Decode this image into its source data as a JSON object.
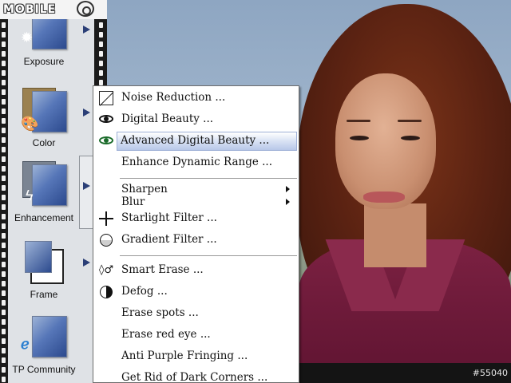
{
  "logo": {
    "text": "MOBILE"
  },
  "sidebar": {
    "tools": [
      {
        "label": "Exposure"
      },
      {
        "label": "Color"
      },
      {
        "label": "Enhancement"
      },
      {
        "label": "Frame"
      },
      {
        "label": "TP Community"
      }
    ]
  },
  "menu": {
    "items": [
      {
        "label": "Noise Reduction ...",
        "icon": "noise-reduction-icon"
      },
      {
        "label": "Digital Beauty ...",
        "icon": "eye-icon"
      },
      {
        "label": "Advanced Digital Beauty ...",
        "icon": "green-eye-icon",
        "highlighted": true
      },
      {
        "label": "Enhance Dynamic Range ...",
        "icon": ""
      },
      {
        "label": "Sharpen",
        "submenu": true
      },
      {
        "label": "Blur",
        "submenu": true
      },
      {
        "label": "Starlight Filter ...",
        "icon": "starlight-icon"
      },
      {
        "label": "Gradient Filter ...",
        "icon": "gradient-icon"
      },
      {
        "label": "Smart Erase ...",
        "icon": "smart-erase-icon"
      },
      {
        "label": "Defog ...",
        "icon": "defog-icon"
      },
      {
        "label": "Erase spots ...",
        "icon": ""
      },
      {
        "label": "Erase red eye ...",
        "icon": ""
      },
      {
        "label": "Anti Purple Fringing ...",
        "icon": ""
      },
      {
        "label": "Get Rid of Dark Corners ...",
        "icon": ""
      }
    ]
  },
  "watermark": {
    "text": "#55040"
  },
  "colors": {
    "menu_highlight": "#b7c7e8",
    "shirt": "#7c2142",
    "hair": "#5a2212"
  }
}
